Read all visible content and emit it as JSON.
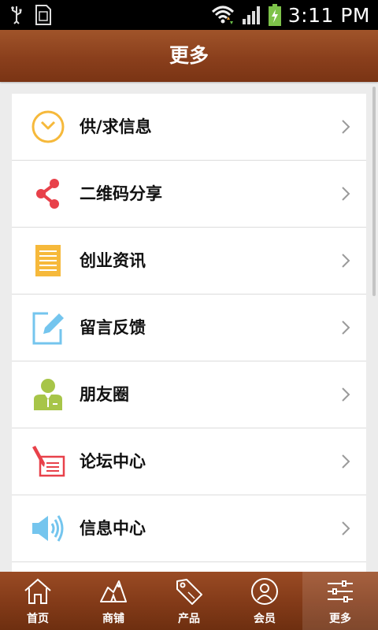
{
  "status_bar": {
    "time": "3:11 PM"
  },
  "header": {
    "title": "更多"
  },
  "menu": {
    "items": [
      {
        "label": "供/求信息",
        "icon": "clock-icon"
      },
      {
        "label": "二维码分享",
        "icon": "share-icon"
      },
      {
        "label": "创业资讯",
        "icon": "document-icon"
      },
      {
        "label": "留言反馈",
        "icon": "edit-icon"
      },
      {
        "label": "朋友圈",
        "icon": "person-icon"
      },
      {
        "label": "论坛中心",
        "icon": "forum-icon"
      },
      {
        "label": "信息中心",
        "icon": "speaker-icon"
      }
    ]
  },
  "bottom_nav": {
    "tabs": [
      {
        "label": "首页",
        "icon": "home-icon"
      },
      {
        "label": "商铺",
        "icon": "shop-icon"
      },
      {
        "label": "产品",
        "icon": "tag-icon"
      },
      {
        "label": "会员",
        "icon": "member-icon"
      },
      {
        "label": "更多",
        "icon": "sliders-icon",
        "active": true
      }
    ]
  },
  "colors": {
    "header": "#8a3f1c",
    "accent_orange": "#f6b93b",
    "accent_red": "#e8414a",
    "accent_blue": "#74c5ee",
    "accent_green": "#a7c548"
  }
}
